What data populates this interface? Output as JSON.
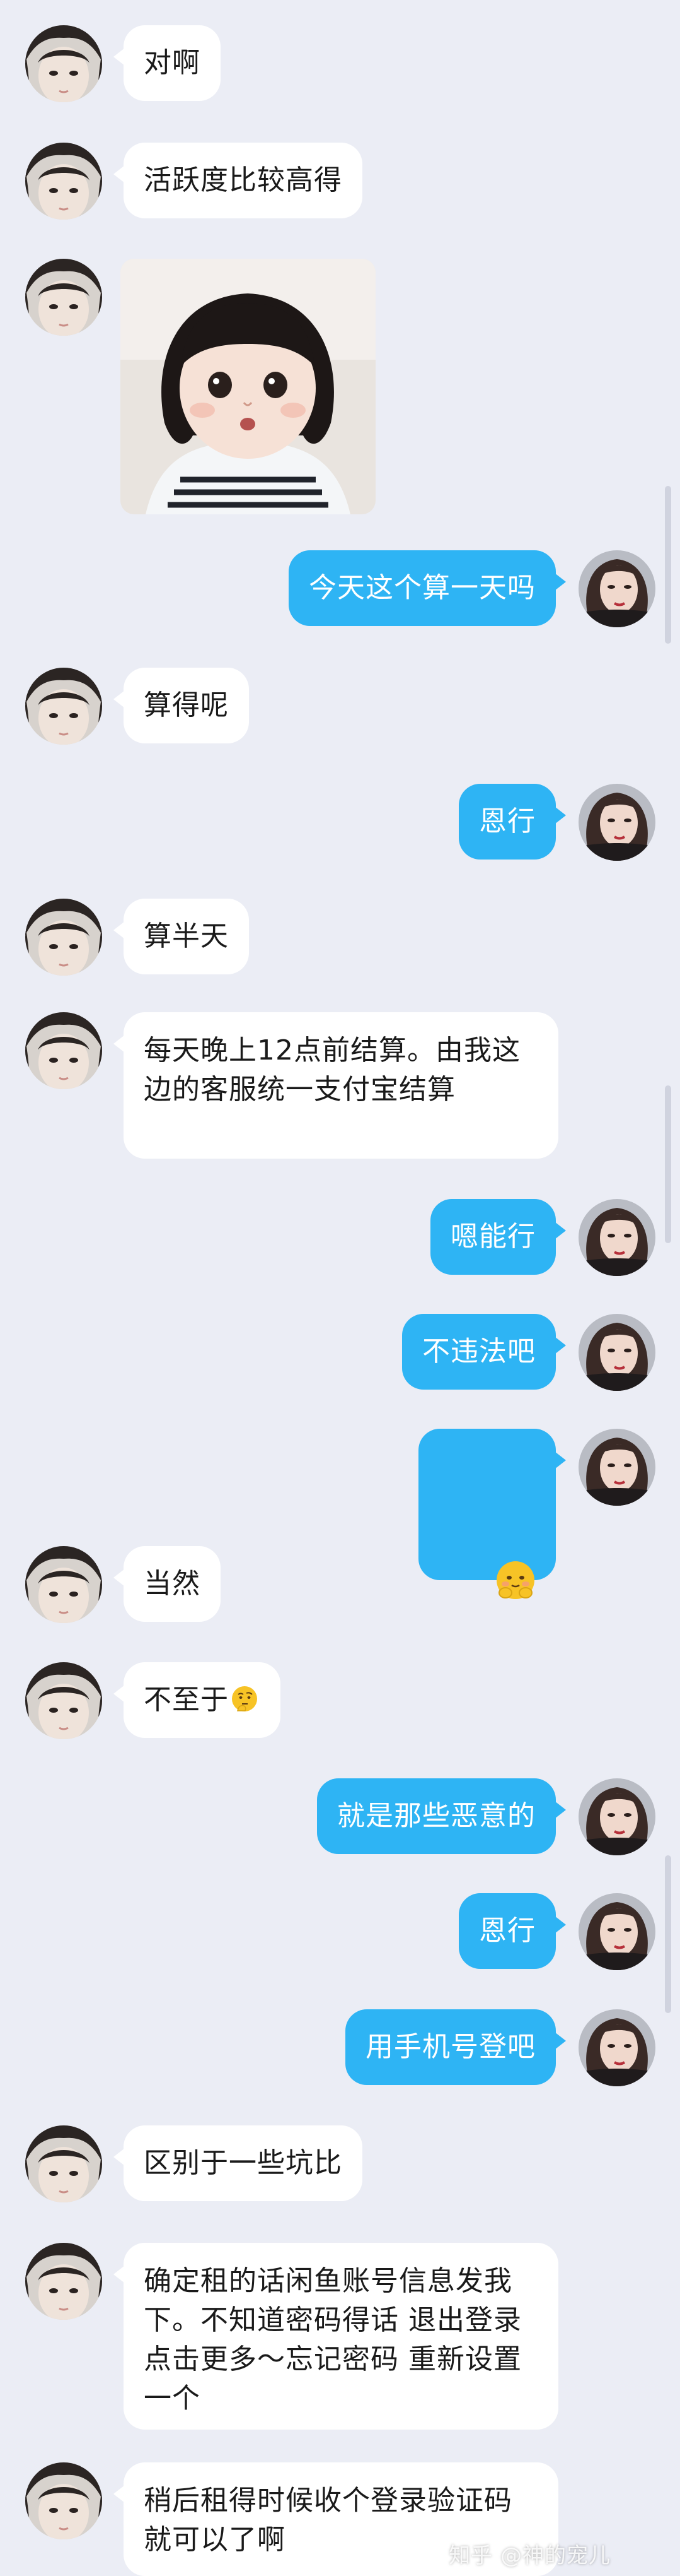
{
  "messages": [
    {
      "side": "in",
      "text": "对啊"
    },
    {
      "side": "in",
      "text": "活跃度比较高得"
    },
    {
      "side": "in",
      "image": "baby-photo"
    },
    {
      "side": "out",
      "text": "今天这个算一天吗"
    },
    {
      "side": "in",
      "text": "算得呢"
    },
    {
      "side": "out",
      "text": "恩行"
    },
    {
      "side": "in",
      "text": "算半天"
    },
    {
      "side": "in",
      "text": "每天晚上12点前结算。由我这边的客服统一支付宝结算"
    },
    {
      "side": "out",
      "text": "嗯能行"
    },
    {
      "side": "out",
      "text": "不违法吧"
    },
    {
      "side": "out",
      "emoji": "shy-hug-emoji"
    },
    {
      "side": "in",
      "text": "当然"
    },
    {
      "side": "in",
      "text": "不至于",
      "emoji": "thinking-emoji"
    },
    {
      "side": "out",
      "text": "就是那些恶意的"
    },
    {
      "side": "out",
      "text": "恩行"
    },
    {
      "side": "out",
      "text": "用手机号登吧"
    },
    {
      "side": "in",
      "text": "区别于一些坑比"
    },
    {
      "side": "in",
      "text": "确定租的话闲鱼账号信息发我下。不知道密码得话 退出登录 点击更多～忘记密码 重新设置一个"
    },
    {
      "side": "in",
      "text": "稍后租得时候收个登录验证码就可以了啊"
    }
  ],
  "watermark": "知乎 @神的宠儿",
  "colors": {
    "background": "#ebedf5",
    "incoming_bubble": "#ffffff",
    "outgoing_bubble": "#2eb4f4",
    "incoming_text": "#1a1a1a",
    "outgoing_text": "#ffffff"
  }
}
